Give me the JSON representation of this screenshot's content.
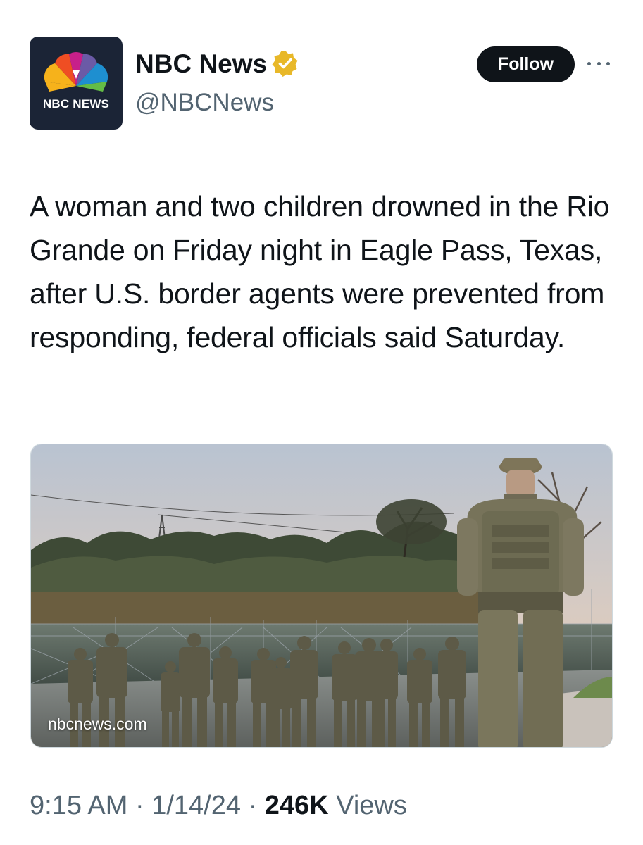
{
  "account": {
    "avatar_text": "NBC NEWS",
    "display_name": "NBC News",
    "handle": "@NBCNews",
    "verified_color": "#E8B829"
  },
  "actions": {
    "follow_label": "Follow"
  },
  "tweet": {
    "text": "A woman and two children drowned in the Rio Grande on Friday night in Eagle Pass, Texas, after U.S. border agents were prevented from responding, federal officials said Saturday."
  },
  "media": {
    "source_label": "nbcnews.com"
  },
  "meta": {
    "time": "9:15 AM",
    "separator": "·",
    "date": "1/14/24",
    "views_count": "246K",
    "views_label": "Views"
  },
  "colors": {
    "text_primary": "#0f1419",
    "text_secondary": "#536471",
    "follow_bg": "#0f1419"
  }
}
